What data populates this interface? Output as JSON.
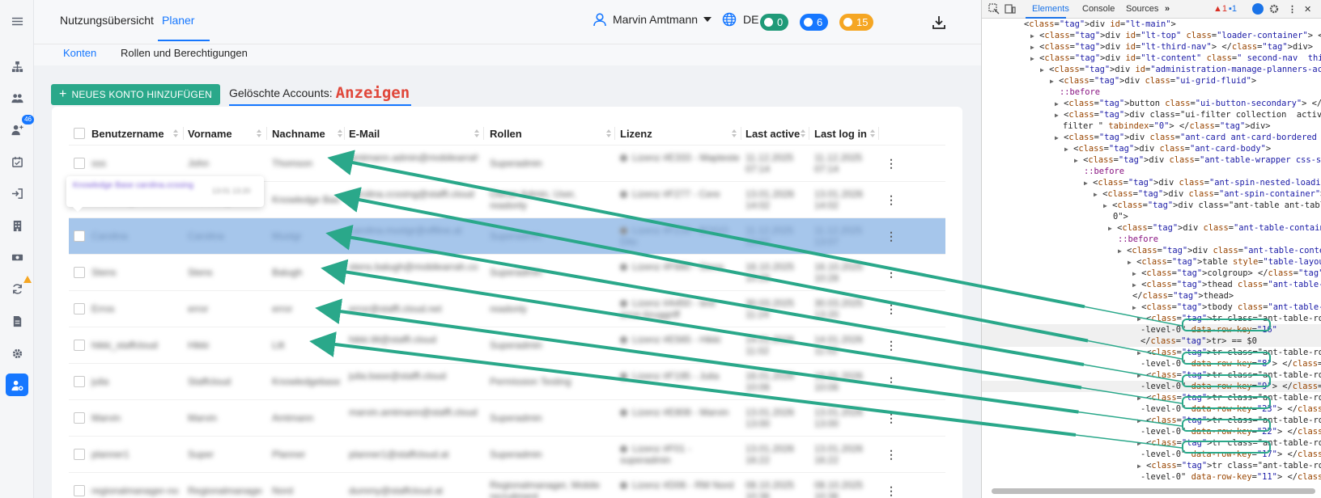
{
  "colors": {
    "accent": "#1677ff",
    "primary_button": "#2aa88a",
    "arrow": "#2aa88a",
    "selected_row": "#a6c6eb",
    "annotation": "#e0473a"
  },
  "nav_rail": {
    "icons": [
      "menu-icon",
      "org-chart-icon",
      "users-icon",
      "add-user-icon",
      "calendar-check-icon",
      "login-icon",
      "building-icon",
      "money-icon",
      "sync-icon",
      "document-icon",
      "settings-icon",
      "user-settings-icon"
    ],
    "badge_count": "46"
  },
  "header": {
    "tabs": [
      "Nutzungsübersicht",
      "Planer"
    ],
    "active_tab": "Planer",
    "user_name": "Marvin Amtmann",
    "language": "DE",
    "counters": [
      {
        "icon": "chat-icon",
        "value": "0",
        "color": "#1f9a78"
      },
      {
        "icon": "bell-icon",
        "value": "6",
        "color": "#1677ff"
      },
      {
        "icon": "clock-icon",
        "value": "15",
        "color": "#f5a623"
      }
    ]
  },
  "subnav": {
    "tabs": [
      "Konten",
      "Rollen und Berechtigungen"
    ],
    "active_tab": "Konten"
  },
  "toolbar": {
    "add_button": "NEUES KONTO HINZUFÜGEN",
    "deleted_label": "Gelöschte Accounts:",
    "deleted_value": "Anzeigen"
  },
  "table": {
    "columns": [
      "Benutzername",
      "Vorname",
      "Nachname",
      "E-Mail",
      "Rollen",
      "Lizenz",
      "Last active",
      "Last log in"
    ],
    "rows": [
      {
        "cells": [
          "sss",
          "John",
          "Thomson",
          "amtmann.admin@mobilearrah.com",
          "Superadmin",
          "Lizenz #E333 - Mapteste",
          "11.12.2025 07:14",
          "11.12.2025 07:14"
        ]
      },
      {
        "cells": [
          "Knowledge Base",
          "Knowledge",
          "Knowledge Base",
          "carolina.ccssing@staffl.cloud",
          "Owner Admin, User, readonly",
          "Lizenz #F277 - Cere",
          "13.01.2026 14:02",
          "13.01.2026 14:02"
        ]
      },
      {
        "cells": [
          "Carolina",
          "Carolina",
          "Mustgr",
          "carolina.mustgr@offline.at",
          "Superadmin",
          "Lizenz #F216 - BOGO Dito",
          "11.12.2025 13:07",
          "11.12.2025 13:07"
        ]
      },
      {
        "cells": [
          "Stens",
          "Stens",
          "Balugh",
          "stens.balugh@mobilearrah.com",
          "Superadmin",
          "Lizenz #F660 - Stens",
          "16.10.2025 10:28",
          "16.10.2025 10:28"
        ]
      },
      {
        "cells": [
          "Erros",
          "error",
          "error",
          "error@staffl.cloud.net",
          "readonly",
          "Lizenz #A450 - test error-lizuggriff",
          "30.03.2025 11:24",
          "30.03.2025 13:20"
        ]
      },
      {
        "cells": [
          "hikki_staffcloud",
          "Hikki",
          "Lilt",
          "hikki.lilt@staffl.cloud",
          "Superadmin",
          "Lizenz #E565 - Hikki",
          "14.01.2026 11:02",
          "14.01.2026 11:02"
        ]
      },
      {
        "cells": [
          "julia",
          "Staffcloud",
          "Knowledgebase",
          "julia.base@staffl.cloud",
          "Permission Testing",
          "Lizenz #F195 - Julia",
          "16.01.2026 10:06",
          "16.01.2026 10:06"
        ]
      },
      {
        "cells": [
          "Marvin",
          "Marvin",
          "Amtmann",
          "marvin.amtmann@staffl.cloud",
          "Superadmin",
          "Lizenz #E808 - Marvin",
          "13.01.2026 13:00",
          "13.01.2026 13:00"
        ]
      },
      {
        "cells": [
          "planner1",
          "Super",
          "Planner",
          "planner1@staffcloud.at",
          "Superadmin",
          "Lizenz #F01 - superadmin",
          "13.01.2026 16:22",
          "13.01.2026 16:22"
        ]
      },
      {
        "cells": [
          "regionalmanager-nord",
          "Regionalmanager",
          "Nord",
          "dummy@staffcloud.at",
          "Regionalmanager, Mobile recruitment",
          "Lizenz #D06 - RM Nord",
          "08.10.2025 10:36",
          "08.10.2025 10:36"
        ]
      }
    ],
    "selected_row": 3,
    "row_menu_icon": "more-vertical-icon"
  },
  "tooltip": {
    "text": "Knowledge Base carolina.ccssing",
    "meta": "13:01 13:20"
  },
  "devtools": {
    "tabs": [
      "Elements",
      "Console",
      "Sources"
    ],
    "active_tab": "Elements",
    "warnings": "1",
    "messages": "1",
    "lines": [
      "<div id=\"lt-main\">",
      "<div id=\"lt-top\" class=\"loader-container\"> </div>",
      "<div id=\"lt-third-nav\"> </div>",
      "<div id=\"lt-content\" class=\" second-nav  third-nav \">",
      "<div id=\"administration-manage-planners-accounts\">",
      "<div class=\"ui-grid-fluid\">",
      "::before",
      "<button class=\"ui-button-secondary\"> </button>",
      "<div class=\"ui-filter collection  active  disabled-reset-",
      "filter \" tabindex=\"0\"> </div>",
      "<div class=\"ant-card ant-card-bordered css-ssx2q0\">",
      "<div class=\"ant-card-body\">",
      "<div class=\"ant-table-wrapper css-ssx2q0\">",
      "::before",
      "<div class=\"ant-spin-nested-loading css-ssx2q0\">",
      "<div class=\"ant-spin-container\">",
      "<div class=\"ant-table ant-table-small css-ssx2q",
      "0\">",
      "<div class=\"ant-table-container\">",
      "::before",
      "<div class=\"ant-table-content\">",
      "<table style=\"table-layout: auto;\">",
      "<colgroup> </colgroup>",
      "<thead class=\"ant-table-thead\">",
      "</thead>",
      "<tbody class=\"ant-table-tbody\">",
      "<tr class=\"ant-table-row ant-table-row",
      "-level-0\" data-row-key=\"16\"",
      "</tr> == $0",
      "<tr class=\"ant-table-row ant-table-row",
      "-level-0\" data-row-key=\"8\"> </tr>",
      "<tr class=\"ant-table-row ant-table-row",
      "-level-0\" data-row-key=\"9\"> </tr>",
      "<tr class=\"ant-table-row ant-table-row",
      "-level-0\" data-row-key=\"23\"> </tr>",
      "<tr class=\"ant-table-row ant-table-row",
      "-level-0\" data-row-key=\"22\"> </tr>",
      "<tr class=\"ant-table-row ant-table-row",
      "-level-0\" data-row-key=\"17\"> </tr>",
      "<tr class=\"ant-table-row ant-table-row",
      "-level-0\" data-row-key=\"11\"> </tr>"
    ],
    "highlighted_keys": [
      "data-row-key=\"16\"",
      "data-row-key=\"8\"",
      "data-row-key=\"9\"",
      "data-row-key=\"23\"",
      "data-row-key=\"22\"",
      "data-row-key=\"17\""
    ]
  }
}
